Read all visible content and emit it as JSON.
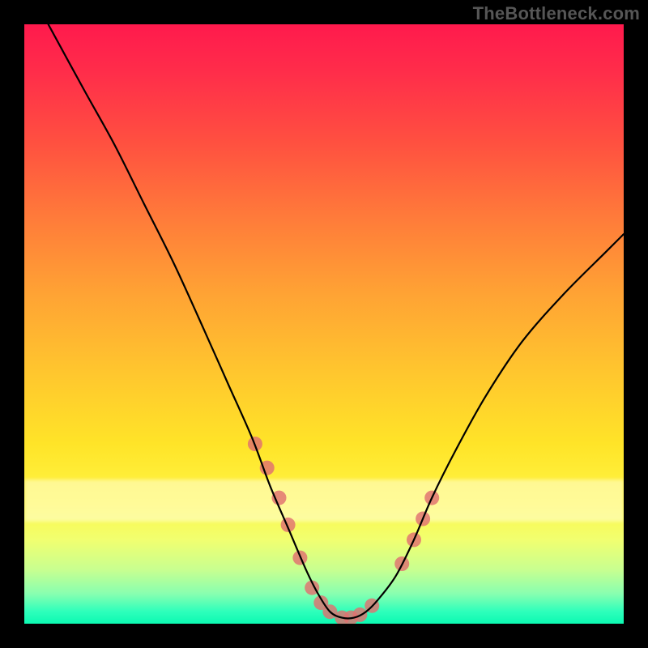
{
  "watermark": "TheBottleneck.com",
  "chart_data": {
    "type": "line",
    "title": "",
    "xlabel": "",
    "ylabel": "",
    "xlim": [
      0,
      100
    ],
    "ylim": [
      0,
      100
    ],
    "grid": false,
    "legend": false,
    "series": [
      {
        "name": "curve",
        "color": "#000000",
        "x": [
          4,
          10,
          15,
          20,
          25,
          30,
          34,
          38,
          41,
          44,
          47,
          49,
          51,
          53,
          55,
          57,
          59,
          62,
          65,
          68,
          72,
          77,
          83,
          90,
          97,
          100
        ],
        "y": [
          100,
          89,
          80,
          70,
          60,
          49,
          40,
          31,
          23,
          16,
          9,
          5,
          2,
          1,
          1,
          2,
          4,
          8,
          14,
          21,
          29,
          38,
          47,
          55,
          62,
          65
        ]
      }
    ],
    "markers": {
      "name": "highlight-dots",
      "color": "#e17070",
      "radius": 9,
      "x": [
        38.5,
        40.5,
        42.5,
        44,
        46,
        48,
        49.5,
        51,
        53,
        54.5,
        56,
        58,
        63,
        65,
        66.5,
        68
      ],
      "y": [
        30,
        26,
        21,
        16.5,
        11,
        6,
        3.5,
        2,
        1,
        1,
        1.5,
        3,
        10,
        14,
        17.5,
        21
      ]
    },
    "background": {
      "gradient": [
        "#ff1a4d",
        "#ff2d4a",
        "#ff5140",
        "#ff7a3a",
        "#ffa334",
        "#ffc62e",
        "#ffe428",
        "#fff645",
        "#f1ff70",
        "#c8ff90",
        "#88ffb0",
        "#2dffbb",
        "#0cf9b2"
      ],
      "direction": "top-to-bottom"
    }
  }
}
